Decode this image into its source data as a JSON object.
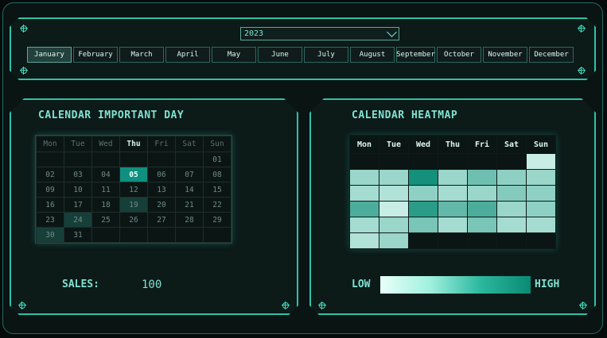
{
  "year_select": {
    "value": "2023"
  },
  "months": [
    "January",
    "February",
    "March",
    "April",
    "May",
    "June",
    "July",
    "August",
    "September",
    "October",
    "November",
    "December"
  ],
  "active_month": "January",
  "calendar": {
    "title": "CALENDAR IMPORTANT DAY",
    "weekdays": [
      "Mon",
      "Tue",
      "Wed",
      "Thu",
      "Fri",
      "Sat",
      "Sun"
    ],
    "today_weekday": "Thu",
    "rows": [
      [
        "",
        "",
        "",
        "",
        "",
        "",
        "01"
      ],
      [
        "02",
        "03",
        "04",
        "05",
        "06",
        "07",
        "08"
      ],
      [
        "09",
        "10",
        "11",
        "12",
        "13",
        "14",
        "15"
      ],
      [
        "16",
        "17",
        "18",
        "19",
        "20",
        "21",
        "22"
      ],
      [
        "23",
        "24",
        "25",
        "26",
        "27",
        "28",
        "29"
      ],
      [
        "30",
        "31",
        "",
        "",
        "",
        "",
        ""
      ]
    ],
    "highlighted_day": "05",
    "marked_days": [
      "19",
      "24",
      "30"
    ],
    "sales_label": "SALES:",
    "sales_value": "100"
  },
  "heatmap": {
    "title": "CALENDAR HEATMAP",
    "weekdays": [
      "Mon",
      "Tue",
      "Wed",
      "Thu",
      "Fri",
      "Sat",
      "Sun"
    ],
    "levels": [
      [
        null,
        null,
        null,
        null,
        null,
        null,
        0.15
      ],
      [
        0.35,
        0.35,
        0.95,
        0.35,
        0.55,
        0.4,
        0.35
      ],
      [
        0.3,
        0.25,
        0.4,
        0.3,
        0.35,
        0.45,
        0.4
      ],
      [
        0.7,
        0.15,
        0.85,
        0.6,
        0.7,
        0.35,
        0.4
      ],
      [
        0.3,
        0.35,
        0.5,
        0.3,
        0.5,
        0.3,
        0.3
      ],
      [
        0.25,
        0.35,
        null,
        null,
        null,
        null,
        null
      ]
    ],
    "legend_low": "LOW",
    "legend_high": "HIGH"
  },
  "colors": {
    "accent": "#2ec2a8",
    "highlight": "#0f8f7f",
    "heat_low": "#e8fff9",
    "heat_high": "#0a8a74"
  }
}
